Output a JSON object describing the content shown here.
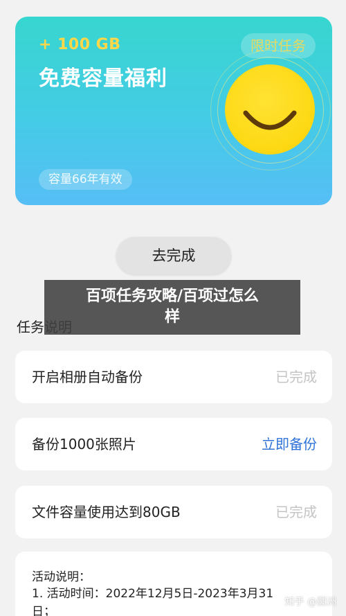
{
  "banner": {
    "amount": "+ 100 GB",
    "title": "免费容量福利",
    "badge": "限时任务",
    "validity": "容量66年有效",
    "colors": {
      "gradient_top": "#37d6cf",
      "gradient_bottom": "#56bef5",
      "amount": "#ffd84a",
      "sun": "#fdd812"
    },
    "icon": "smiling-sun-icon"
  },
  "go_button": {
    "label": "去完成"
  },
  "overlay": {
    "line1": "百项任务攻略/百项过怎么",
    "line2": "样"
  },
  "section_title": "任务说明",
  "tasks": [
    {
      "name": "开启相册自动备份",
      "status": "已完成",
      "state": "done"
    },
    {
      "name": "备份1000张照片",
      "status": "立即备份",
      "state": "action"
    },
    {
      "name": "文件容量使用达到80GB",
      "status": "已完成",
      "state": "done"
    }
  ],
  "notes": {
    "title": "活动说明：",
    "line1": "1. 活动时间：2022年12月5日-2023年3月31",
    "line2": "日；"
  },
  "watermark": "知乎 @圆洲",
  "colors": {
    "action_blue": "#2f73d9",
    "done_gray": "#c4c4c4",
    "page_bg": "#f2f2f2"
  }
}
